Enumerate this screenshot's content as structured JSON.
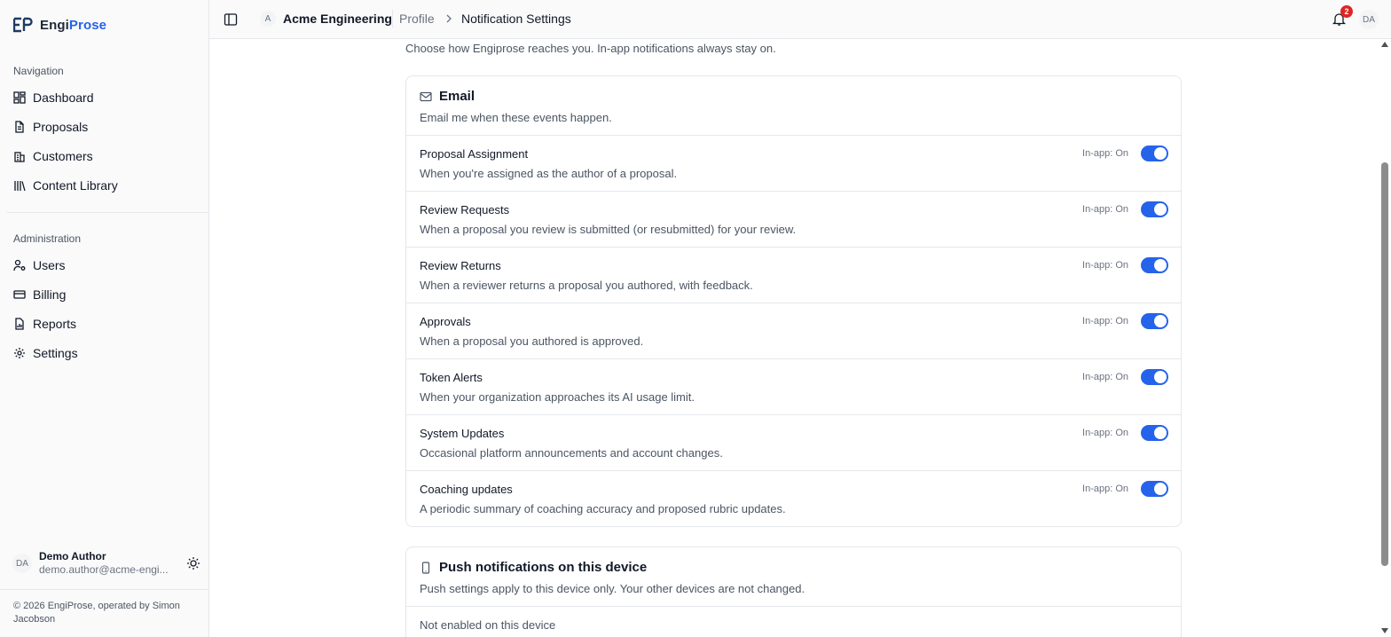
{
  "brand": {
    "prefix": "Engi",
    "accent": "Prose"
  },
  "sidebar": {
    "navigation_label": "Navigation",
    "navigation": [
      {
        "label": "Dashboard",
        "icon": "dashboard-icon"
      },
      {
        "label": "Proposals",
        "icon": "document-icon"
      },
      {
        "label": "Customers",
        "icon": "building-icon"
      },
      {
        "label": "Content Library",
        "icon": "library-icon"
      }
    ],
    "administration_label": "Administration",
    "administration": [
      {
        "label": "Users",
        "icon": "user-cog-icon"
      },
      {
        "label": "Billing",
        "icon": "credit-card-icon"
      },
      {
        "label": "Reports",
        "icon": "report-icon"
      },
      {
        "label": "Settings",
        "icon": "gear-icon"
      }
    ],
    "user": {
      "initials": "DA",
      "name": "Demo Author",
      "email": "demo.author@acme-engi..."
    },
    "copyright": "© 2026 EngiProse, operated by Simon Jacobson"
  },
  "topbar": {
    "org_initial": "A",
    "org_name": "Acme Engineering",
    "breadcrumb_parent": "Profile",
    "breadcrumb_current": "Notification Settings",
    "notification_count": "2",
    "avatar_initials": "DA"
  },
  "main": {
    "intro": "Choose how Engiprose reaches you. In-app notifications always stay on.",
    "email_card": {
      "title": "Email",
      "description": "Email me when these events happen.",
      "rows": [
        {
          "title": "Proposal Assignment",
          "description": "When you're assigned as the author of a proposal.",
          "inapp": "In-app: On",
          "enabled": true
        },
        {
          "title": "Review Requests",
          "description": "When a proposal you review is submitted (or resubmitted) for your review.",
          "inapp": "In-app: On",
          "enabled": true
        },
        {
          "title": "Review Returns",
          "description": "When a reviewer returns a proposal you authored, with feedback.",
          "inapp": "In-app: On",
          "enabled": true
        },
        {
          "title": "Approvals",
          "description": "When a proposal you authored is approved.",
          "inapp": "In-app: On",
          "enabled": true
        },
        {
          "title": "Token Alerts",
          "description": "When your organization approaches its AI usage limit.",
          "inapp": "In-app: On",
          "enabled": true
        },
        {
          "title": "System Updates",
          "description": "Occasional platform announcements and account changes.",
          "inapp": "In-app: On",
          "enabled": true
        },
        {
          "title": "Coaching updates",
          "description": "A periodic summary of coaching accuracy and proposed rubric updates.",
          "inapp": "In-app: On",
          "enabled": true
        }
      ]
    },
    "push_card": {
      "title": "Push notifications on this device",
      "description": "Push settings apply to this device only. Your other devices are not changed.",
      "status": "Not enabled on this device"
    }
  },
  "colors": {
    "accent": "#2563eb",
    "badge": "#dc2626"
  }
}
